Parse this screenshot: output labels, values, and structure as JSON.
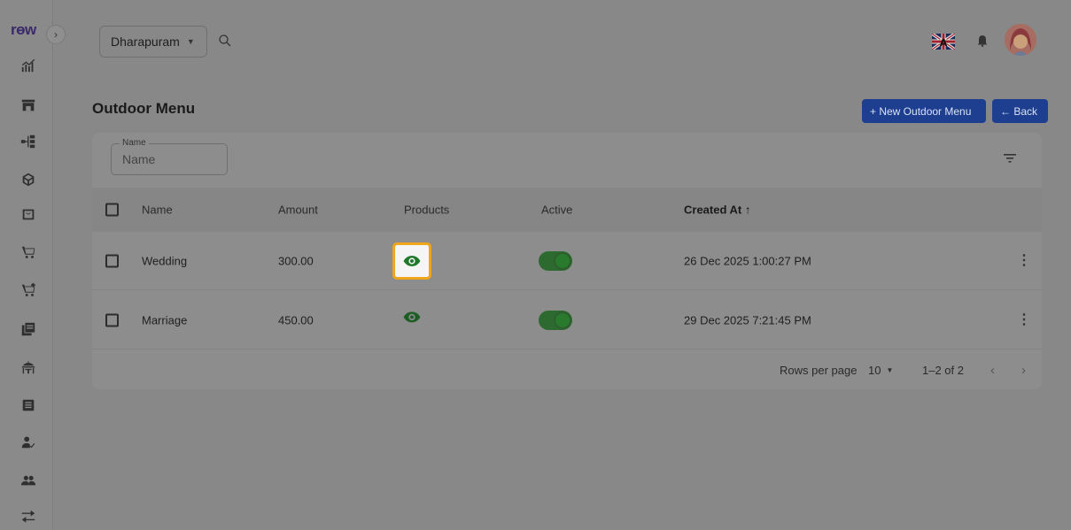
{
  "brand": {
    "logo": "rɵw"
  },
  "sidebar": {
    "items": [
      {
        "icon": "analytics-icon"
      },
      {
        "icon": "store-icon"
      },
      {
        "icon": "hierarchy-icon"
      },
      {
        "icon": "box-icon"
      },
      {
        "icon": "bag-icon"
      },
      {
        "icon": "cart-icon"
      },
      {
        "icon": "cart-add-icon"
      },
      {
        "icon": "copy-icon"
      },
      {
        "icon": "dining-icon"
      },
      {
        "icon": "list-icon"
      },
      {
        "icon": "user-check-icon"
      },
      {
        "icon": "users-icon"
      },
      {
        "icon": "transfer-icon"
      }
    ]
  },
  "topbar": {
    "branch": "Dharapuram"
  },
  "page": {
    "title": "Outdoor Menu",
    "new_button": "+ New Outdoor Menu",
    "back_button": "← Back"
  },
  "filter": {
    "legend": "Name",
    "placeholder": "Name"
  },
  "table": {
    "headers": {
      "name": "Name",
      "amount": "Amount",
      "products": "Products",
      "active": "Active",
      "created": "Created At ↑"
    },
    "rows": [
      {
        "name": "Wedding",
        "amount": "300.00",
        "active": true,
        "created": "26 Dec 2025 1:00:27 PM"
      },
      {
        "name": "Marriage",
        "amount": "450.00",
        "active": true,
        "created": "29 Dec 2025 7:21:45 PM"
      }
    ]
  },
  "pagination": {
    "rows_label": "Rows per page",
    "rows_value": "10",
    "range": "1–2 of 2"
  },
  "colors": {
    "accent": "#1e3f8f",
    "toggle": "#2d6a2f",
    "highlight": "#f0a51a"
  }
}
